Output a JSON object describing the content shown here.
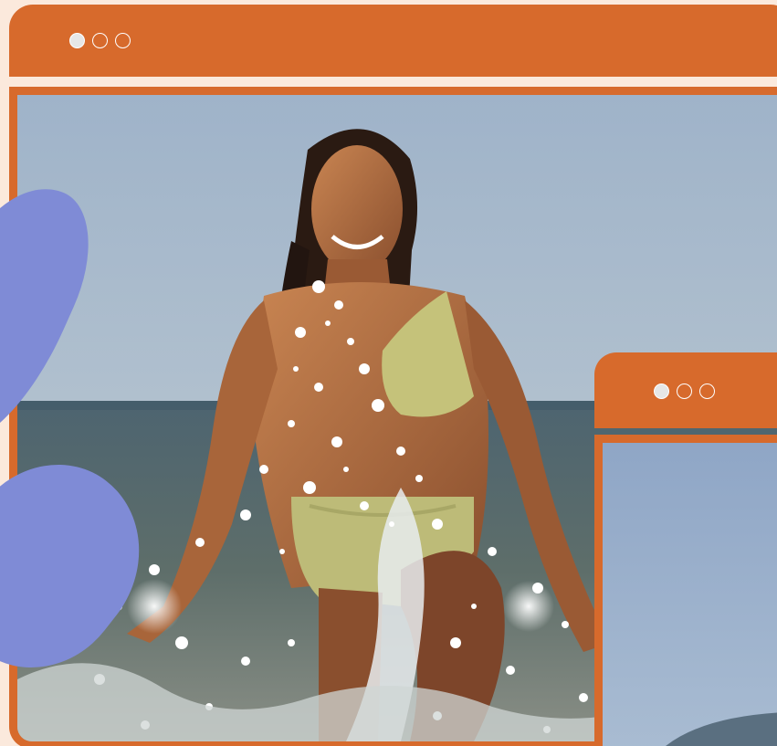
{
  "colors": {
    "window_frame": "#d76a2c",
    "page_background": "#fbe9dc",
    "decorative_blob": "#7f8bd6",
    "window_dot": "#ffffff"
  },
  "main_window": {
    "controls": [
      {
        "icon": "filled-circle-icon",
        "filled": true
      },
      {
        "icon": "outline-circle-icon",
        "filled": false
      },
      {
        "icon": "outline-circle-icon",
        "filled": false
      }
    ],
    "photo": {
      "subject": "photo-woman-splashing-in-sea"
    }
  },
  "secondary_window": {
    "controls": [
      {
        "icon": "filled-circle-icon",
        "filled": true
      },
      {
        "icon": "outline-circle-icon",
        "filled": false
      },
      {
        "icon": "outline-circle-icon",
        "filled": false
      }
    ],
    "photo": {
      "subject": "photo-sky-and-sea"
    }
  }
}
